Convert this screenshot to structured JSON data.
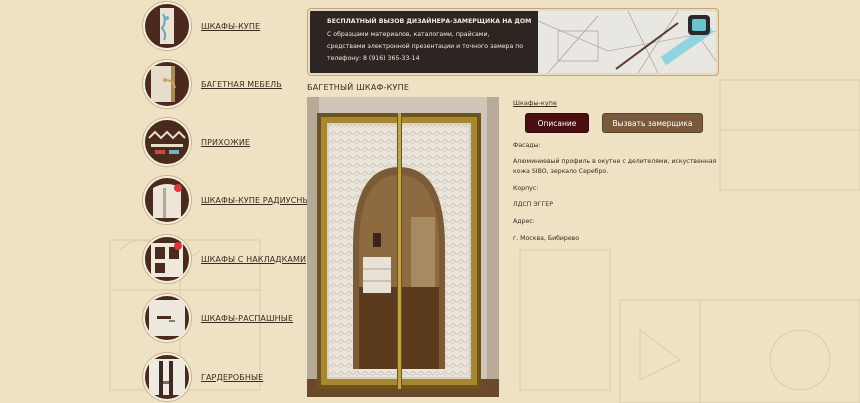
{
  "nav": [
    {
      "label": "ШКАФЫ-КУПЕ",
      "icon": "wardrobe-icon"
    },
    {
      "label": "БАГЕТНАЯ МЕБЕЛЬ",
      "icon": "baguette-furniture-icon"
    },
    {
      "label": "ПРИХОЖИЕ",
      "icon": "hallway-icon"
    },
    {
      "label": "ШКАФЫ-КУПЕ РАДИУСНЫЕ",
      "icon": "radius-wardrobe-icon"
    },
    {
      "label": "ШКАФЫ С НАКЛАДКАМИ",
      "icon": "overlay-wardrobe-icon"
    },
    {
      "label": "ШКАФЫ-РАСПАШНЫЕ",
      "icon": "swing-wardrobe-icon"
    },
    {
      "label": "ГАРДЕРОБНЫЕ",
      "icon": "walk-in-closet-icon"
    }
  ],
  "banner": {
    "title": "БЕСПЛАТНЫЙ ВЫЗОВ ДИЗАЙНЕРА-ЗАМЕРЩИКА НА ДОМ",
    "lines": [
      "С образцами материалов, каталогами, прайсами,",
      "средствами электронной презентации и точного замера по",
      "телефону: 8 (916) 365-33-14"
    ]
  },
  "page_title": "БАГЕТНЫЙ ШКАФ-КУПЕ",
  "breadcrumb": "Шкафы-купе",
  "buttons": {
    "description": "Описание",
    "call_measurer": "Вызвать замерщика"
  },
  "info": {
    "facades_label": "Фасады:",
    "facades_value": "Алюминиевый профиль в окутне с делителями, искуственная",
    "facades_value_2": "кожа SIBO, зеркало Серебро.",
    "body_label": "Корпус:",
    "body_value": "ЛДСП ЭГГЕР",
    "address_label": "Адрес:",
    "address_value": "г. Москва, Бибирево"
  },
  "colors": {
    "background": "#efe2c4",
    "dark_brown": "#4a2a1d",
    "button_dark": "#4a0d10",
    "button_brown": "#7a5a3a",
    "banner_bg": "#2d2521"
  }
}
